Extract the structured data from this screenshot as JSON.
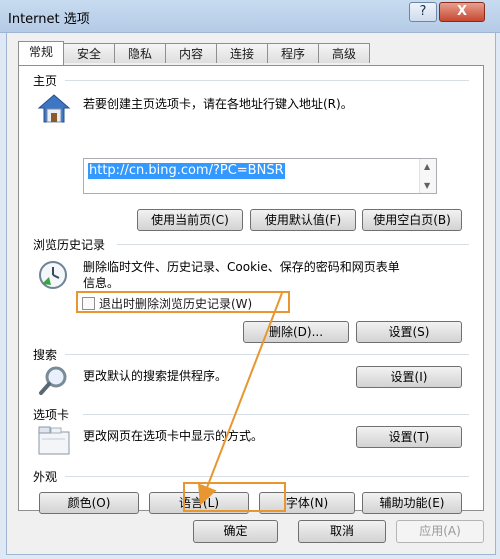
{
  "window": {
    "title": "Internet 选项",
    "help_button": "?",
    "close_button": "X"
  },
  "tabs": [
    "常规",
    "安全",
    "隐私",
    "内容",
    "连接",
    "程序",
    "高级"
  ],
  "home": {
    "heading": "主页",
    "description": "若要创建主页选项卡，请在各地址行键入地址(R)。",
    "url": "http://cn.bing.com/?PC=BNSR",
    "btn_current": "使用当前页(C)",
    "btn_default": "使用默认值(F)",
    "btn_blank": "使用空白页(B)"
  },
  "history": {
    "heading": "浏览历史记录",
    "description_line1": "删除临时文件、历史记录、Cookie、保存的密码和网页表单",
    "description_line2": "信息。",
    "checkbox_label": "退出时删除浏览历史记录(W)",
    "btn_delete": "删除(D)...",
    "btn_settings": "设置(S)"
  },
  "search": {
    "heading": "搜索",
    "description": "更改默认的搜索提供程序。",
    "btn_settings": "设置(I)"
  },
  "tabs_section": {
    "heading": "选项卡",
    "description": "更改网页在选项卡中显示的方式。",
    "btn_settings": "设置(T)"
  },
  "appearance": {
    "heading": "外观",
    "btn_colors": "颜色(O)",
    "btn_languages": "语言(L)",
    "btn_fonts": "字体(N)",
    "btn_accessibility": "辅助功能(E)"
  },
  "footer": {
    "btn_ok": "确定",
    "btn_cancel": "取消",
    "btn_apply": "应用(A)"
  },
  "colors": {
    "highlight": "#e8962f",
    "selection": "#3399ff"
  }
}
